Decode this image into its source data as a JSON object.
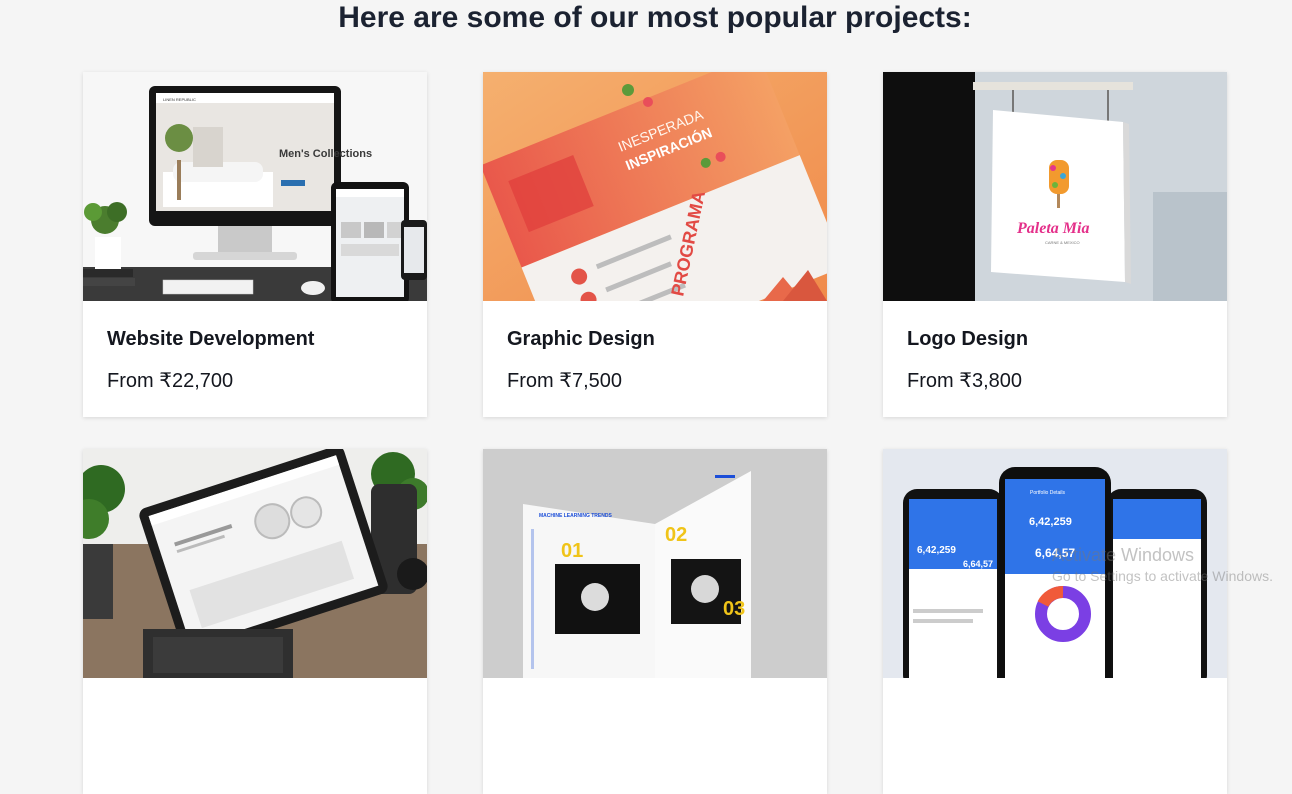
{
  "section": {
    "heading": "Here are some of our most popular projects:"
  },
  "cards": [
    {
      "title": "Website Development",
      "price": "From ₹22,700"
    },
    {
      "title": "Graphic Design",
      "price": "From ₹7,500"
    },
    {
      "title": "Logo Design",
      "price": "From ₹3,800"
    },
    {
      "title": "",
      "price": ""
    },
    {
      "title": "",
      "price": ""
    },
    {
      "title": "",
      "price": ""
    }
  ],
  "thumbs": {
    "website": {
      "brand": "LINEN REPUBLIC",
      "headline": "Men's Collections"
    },
    "graphic": {
      "line1": "INESPERADA",
      "line2": "INSPIRACIÓN",
      "vertical": "PROGRAMA"
    },
    "logo": {
      "brand": "Paleta Mia",
      "sub": "CARNE & MEXICO"
    },
    "book": {
      "tag": "MACHINE LEARNING TRENDS",
      "n1": "01",
      "n2": "02",
      "n3": "03"
    },
    "app": {
      "screen_title": "Portfolio Details",
      "v1": "6,42,259",
      "v2": "6,42,259",
      "v3": "6,64,57",
      "v4": "6,64,57"
    }
  },
  "watermark": {
    "line1": "Activate Windows",
    "line2": "Go to Settings to activate Windows."
  }
}
